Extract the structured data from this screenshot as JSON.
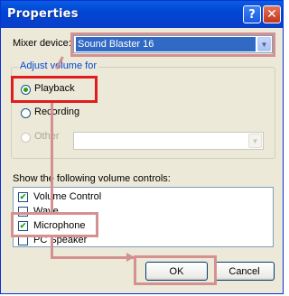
{
  "window": {
    "title": "Properties",
    "help_glyph": "?",
    "close_glyph": "✕"
  },
  "mixer": {
    "label": "Mixer device:",
    "value": "Sound Blaster 16"
  },
  "adjust": {
    "group_label": "Adjust volume for",
    "options": [
      {
        "label": "Playback",
        "checked": true,
        "enabled": true
      },
      {
        "label": "Recording",
        "checked": false,
        "enabled": true
      },
      {
        "label": "Other",
        "checked": false,
        "enabled": false
      }
    ]
  },
  "controls": {
    "label": "Show the following volume controls:",
    "items": [
      {
        "label": "Volume Control",
        "checked": true
      },
      {
        "label": "Wave",
        "checked": false
      },
      {
        "label": "Microphone",
        "checked": true
      },
      {
        "label": "PC Speaker",
        "checked": false
      }
    ]
  },
  "buttons": {
    "ok": "OK",
    "cancel": "Cancel"
  },
  "icons": {
    "check": "✔",
    "dropdown": "▼"
  },
  "annotations": {
    "highlight_color": "#d59191",
    "selected_color": "#e01c1c"
  }
}
